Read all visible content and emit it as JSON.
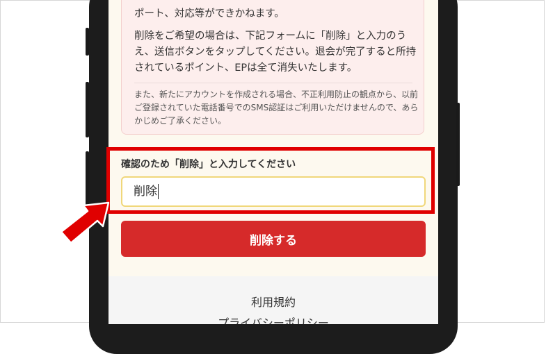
{
  "notice": {
    "top_line": "ポート、対応等ができかねます。",
    "paragraph": "削除をご希望の場合は、下記フォームに「削除」と入力のうえ、送信ボタンをタップしてください。退会が完了すると所持されているポイント、EPは全て消失いたします。",
    "note": "また、新たにアカウントを作成される場合、不正利用防止の観点から、以前ご登録されていた電話番号でのSMS認証はご利用いただけませんので、あらかじめご了承ください。"
  },
  "confirm": {
    "label": "確認のため「削除」と入力してください",
    "input_value": "削除"
  },
  "delete_button": {
    "label": "削除する"
  },
  "footer": {
    "links": [
      "利用規約",
      "プライバシーポリシー"
    ]
  },
  "colors": {
    "accent_red": "#d62a2a",
    "highlight_red": "#e00000",
    "input_border": "#f0d77a",
    "notice_bg": "#fdeeed"
  }
}
